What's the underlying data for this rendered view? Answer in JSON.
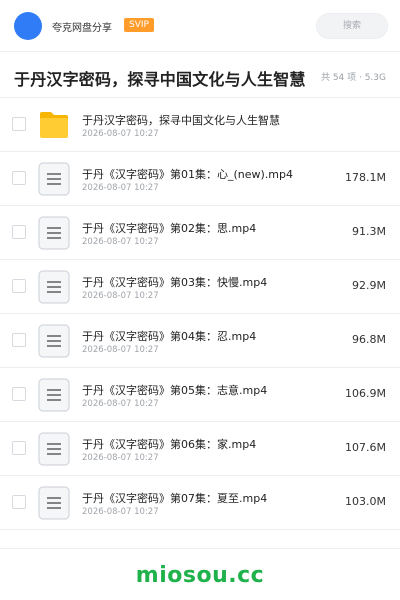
{
  "header": {
    "app_name": "夸克网盘分享",
    "badge": "SVIP",
    "search_placeholder": "搜索",
    "avatar_color": "#2f7cf6",
    "badge_color": "#ff9c2a"
  },
  "folder_header": {
    "title": "于丹汉字密码，探寻中国文化与人生智慧",
    "summary": "共 54 项 · 5.3G"
  },
  "files": [
    {
      "name": "于丹汉字密码，探寻中国文化与人生智慧",
      "date": "2026-08-07 10:27",
      "size": "",
      "icon": "folder-icon"
    },
    {
      "name": "于丹《汉字密码》第01集：心_(new).mp4",
      "date": "2026-08-07 10:27",
      "size": "178.1M",
      "icon": "video-file-icon"
    },
    {
      "name": "于丹《汉字密码》第02集：思.mp4",
      "date": "2026-08-07 10:27",
      "size": "91.3M",
      "icon": "video-file-icon"
    },
    {
      "name": "于丹《汉字密码》第03集：快慢.mp4",
      "date": "2026-08-07 10:27",
      "size": "92.9M",
      "icon": "video-file-icon"
    },
    {
      "name": "于丹《汉字密码》第04集：忍.mp4",
      "date": "2026-08-07 10:27",
      "size": "96.8M",
      "icon": "video-file-icon"
    },
    {
      "name": "于丹《汉字密码》第05集：志意.mp4",
      "date": "2026-08-07 10:27",
      "size": "106.9M",
      "icon": "video-file-icon"
    },
    {
      "name": "于丹《汉字密码》第06集：家.mp4",
      "date": "2026-08-07 10:27",
      "size": "107.6M",
      "icon": "video-file-icon"
    },
    {
      "name": "于丹《汉字密码》第07集：夏至.mp4",
      "date": "2026-08-07 10:27",
      "size": "103.0M",
      "icon": "video-file-icon"
    }
  ],
  "footer": {
    "brand": "miosou.cc",
    "brand_color": "#1fb24b"
  }
}
